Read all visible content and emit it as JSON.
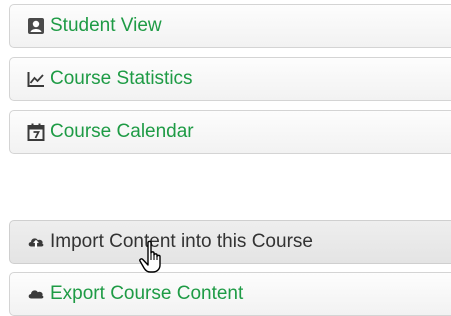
{
  "menu": {
    "items": [
      {
        "label": "Student View",
        "icon": "student-view-icon",
        "color": "#1e9b45"
      },
      {
        "label": "Course Statistics",
        "icon": "statistics-icon",
        "color": "#1e9b45"
      },
      {
        "label": "Course Calendar",
        "icon": "calendar-icon",
        "color": "#1e9b45"
      },
      {
        "label": "Import Content into this Course",
        "icon": "cloud-upload-icon",
        "color": "#333333",
        "state": "hover"
      },
      {
        "label": "Export Course Content",
        "icon": "cloud-download-icon",
        "color": "#1e9b45"
      }
    ]
  }
}
